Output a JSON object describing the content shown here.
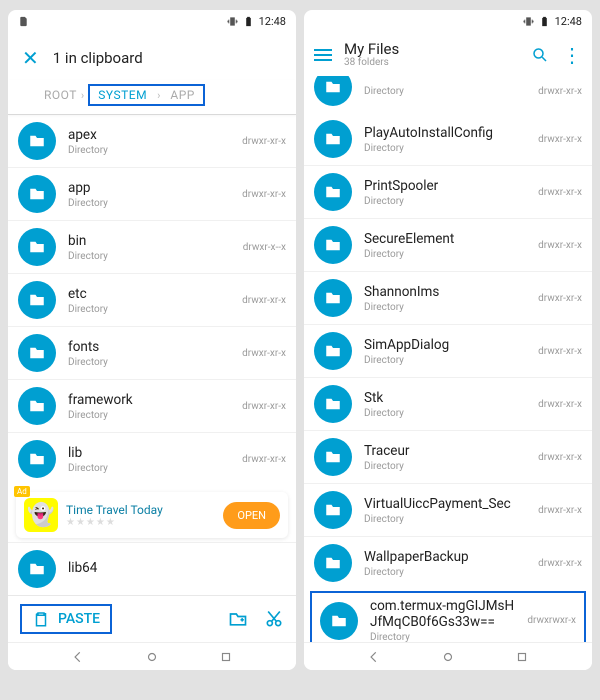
{
  "status": {
    "time": "12:48"
  },
  "left": {
    "title": "1 in clipboard",
    "crumbs": {
      "root": "ROOT",
      "system": "SYSTEM",
      "app": "APP"
    },
    "rows": [
      {
        "name": "apex",
        "sub": "Directory",
        "perm": "drwxr-xr-x"
      },
      {
        "name": "app",
        "sub": "Directory",
        "perm": "drwxr-xr-x"
      },
      {
        "name": "bin",
        "sub": "Directory",
        "perm": "drwxr-x--x"
      },
      {
        "name": "etc",
        "sub": "Directory",
        "perm": "drwxr-xr-x"
      },
      {
        "name": "fonts",
        "sub": "Directory",
        "perm": "drwxr-xr-x"
      },
      {
        "name": "framework",
        "sub": "Directory",
        "perm": "drwxr-xr-x"
      },
      {
        "name": "lib",
        "sub": "Directory",
        "perm": "drwxr-xr-x"
      }
    ],
    "lib64": "lib64",
    "ad": {
      "tag": "Ad",
      "title": "Time Travel Today",
      "button": "OPEN"
    },
    "paste": "PASTE"
  },
  "right": {
    "title": "My Files",
    "subtitle": "38 folders",
    "partial": {
      "sub": "Directory",
      "perm": "drwxr-xr-x"
    },
    "rows": [
      {
        "name": "PlayAutoInstallConfig",
        "sub": "Directory",
        "perm": "drwxr-xr-x"
      },
      {
        "name": "PrintSpooler",
        "sub": "Directory",
        "perm": "drwxr-xr-x"
      },
      {
        "name": "SecureElement",
        "sub": "Directory",
        "perm": "drwxr-xr-x"
      },
      {
        "name": "ShannonIms",
        "sub": "Directory",
        "perm": "drwxr-xr-x"
      },
      {
        "name": "SimAppDialog",
        "sub": "Directory",
        "perm": "drwxr-xr-x"
      },
      {
        "name": "Stk",
        "sub": "Directory",
        "perm": "drwxr-xr-x"
      },
      {
        "name": "Traceur",
        "sub": "Directory",
        "perm": "drwxr-xr-x"
      },
      {
        "name": "VirtualUiccPayment_Sec",
        "sub": "Directory",
        "perm": "drwxr-xr-x"
      },
      {
        "name": "WallpaperBackup",
        "sub": "Directory",
        "perm": "drwxr-xr-x"
      }
    ],
    "highlight": {
      "name": "com.termux-mgGIJMsHJfMqCB0f6Gs33w==",
      "sub": "Directory",
      "perm": "drwxrwxr-x"
    }
  }
}
